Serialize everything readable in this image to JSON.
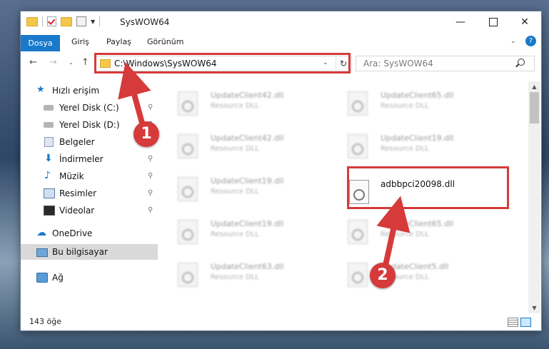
{
  "window": {
    "title": "SysWOW64",
    "minimize": "—",
    "close": "✕"
  },
  "ribbon": {
    "tabs": [
      "Dosya",
      "Giriş",
      "Paylaş",
      "Görünüm"
    ],
    "caret": "⌄",
    "help": "?"
  },
  "nav": {
    "back": "←",
    "forward": "→",
    "recent": "⌄",
    "up": "↑",
    "address": "C:\\Windows\\SysWOW64",
    "address_caret": "⌄",
    "refresh": "↻",
    "search_placeholder": "Ara: SysWOW64"
  },
  "sidebar": {
    "items": [
      {
        "label": "Hızlı erişim",
        "icon": "star-icon",
        "pinned": false
      },
      {
        "label": "Yerel Disk (C:)",
        "icon": "disk-icon",
        "pinned": true
      },
      {
        "label": "Yerel Disk (D:)",
        "icon": "disk-icon",
        "pinned": true
      },
      {
        "label": "Belgeler",
        "icon": "documents-icon",
        "pinned": true
      },
      {
        "label": "İndirmeler",
        "icon": "download-icon",
        "pinned": true
      },
      {
        "label": "Müzik",
        "icon": "music-icon",
        "pinned": true
      },
      {
        "label": "Resimler",
        "icon": "pictures-icon",
        "pinned": true
      },
      {
        "label": "Videolar",
        "icon": "video-icon",
        "pinned": true
      },
      {
        "label": "OneDrive",
        "icon": "cloud-icon",
        "pinned": false
      },
      {
        "label": "Bu bilgisayar",
        "icon": "computer-icon",
        "pinned": false
      },
      {
        "label": "Ağ",
        "icon": "network-icon",
        "pinned": false
      }
    ],
    "pin_glyph": "📌"
  },
  "files": [
    {
      "name": "UpdateClient42.dll",
      "type": "Resource DLL",
      "blurred": true
    },
    {
      "name": "UpdateClient65.dll",
      "type": "Resource DLL",
      "blurred": true
    },
    {
      "name": "UpdateClient42.dll",
      "type": "Resource DLL",
      "blurred": true
    },
    {
      "name": "UpdateClient19.dll",
      "type": "Resource DLL",
      "blurred": true
    },
    {
      "name": "UpdateClient19.dll",
      "type": "Resource DLL",
      "blurred": true
    },
    {
      "name": "adbbpci20098.dll",
      "type": "",
      "blurred": false
    },
    {
      "name": "UpdateClient19.dll",
      "type": "Resource DLL",
      "blurred": true
    },
    {
      "name": "UpdateClient65.dll",
      "type": "Resource DLL",
      "blurred": true
    },
    {
      "name": "UpdateClient63.dll",
      "type": "Resource DLL",
      "blurred": true
    },
    {
      "name": "UpdateClient5.dll",
      "type": "Resource DLL",
      "blurred": true
    }
  ],
  "status": {
    "item_count": "143 öğe"
  },
  "annotations": {
    "step1": "1",
    "step2": "2",
    "color": "#d63a3a"
  },
  "colors": {
    "accent": "#1979ca",
    "selection": "#cce8ff"
  },
  "scroll": {
    "up": "▲",
    "down": "▼"
  }
}
